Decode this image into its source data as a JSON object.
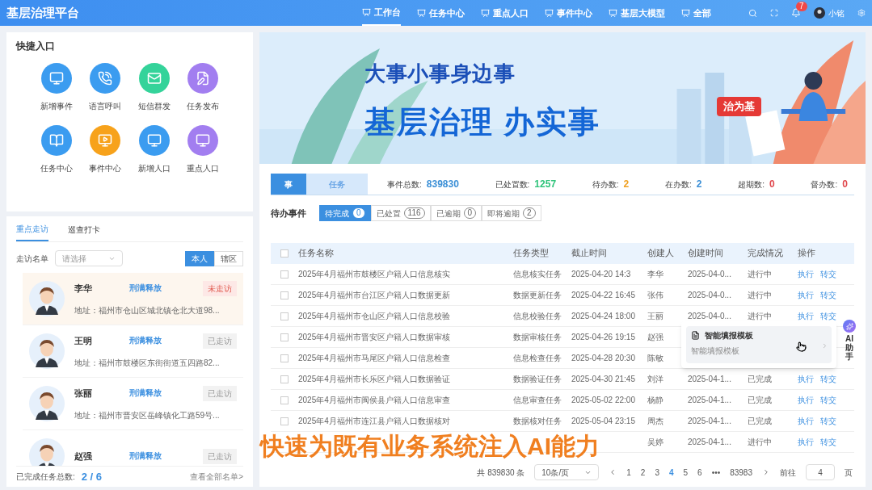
{
  "app": {
    "title": "基层治理平台"
  },
  "nav": [
    {
      "label": "工作台",
      "selected": true
    },
    {
      "label": "任务中心",
      "selected": false
    },
    {
      "label": "重点人口",
      "selected": false
    },
    {
      "label": "事件中心",
      "selected": false
    },
    {
      "label": "基层大模型",
      "selected": false
    },
    {
      "label": "全部",
      "selected": false
    }
  ],
  "notifications": {
    "badge": "7"
  },
  "user": {
    "name": "小铭"
  },
  "quick_entry": {
    "title": "快捷入口",
    "items": [
      {
        "label": "新增事件",
        "color": "#3b9cf0"
      },
      {
        "label": "语言呼叫",
        "color": "#3b9cf0"
      },
      {
        "label": "短信群发",
        "color": "#34d39a"
      },
      {
        "label": "任务发布",
        "color": "#a27ef0"
      },
      {
        "label": "任务中心",
        "color": "#3b9cf0"
      },
      {
        "label": "事件中心",
        "color": "#f7a21b"
      },
      {
        "label": "新增人口",
        "color": "#3b9cf0"
      },
      {
        "label": "重点人口",
        "color": "#a27ef0"
      }
    ]
  },
  "visits": {
    "tabs": [
      {
        "label": "重点走访",
        "selected": true
      },
      {
        "label": "巡查打卡",
        "selected": false
      }
    ],
    "filter": {
      "label": "走访名单",
      "placeholder": "请选择"
    },
    "scope": [
      {
        "label": "本人",
        "selected": true
      },
      {
        "label": "辖区",
        "selected": false
      }
    ],
    "people": [
      {
        "name": "李华",
        "tag": "刑满释放",
        "address": "地址：福州市仓山区城北镇仓北大道98...",
        "status": "未走访",
        "visited": false
      },
      {
        "name": "王明",
        "tag": "刑满释放",
        "address": "地址：福州市鼓楼区东街街道五四路82...",
        "status": "已走访",
        "visited": true
      },
      {
        "name": "张丽",
        "tag": "刑满释放",
        "address": "地址：福州市晋安区岳峰镇化工路59号...",
        "status": "已走访",
        "visited": true
      },
      {
        "name": "赵强",
        "tag": "刑满释放",
        "status": "已走访",
        "visited": true
      }
    ],
    "footer": {
      "label": "已完成任务总数:",
      "value": "2 / 6",
      "link": "查看全部名单>"
    }
  },
  "banner": {
    "slogan": "大事小事身边事",
    "headline": "基层治理 办实事",
    "badge": "治为基"
  },
  "stats": {
    "tabs": [
      {
        "label": "事",
        "selected": true
      },
      {
        "label": "任务",
        "selected": false
      }
    ],
    "items": [
      {
        "label": "事件总数:",
        "value": "839830",
        "color": "#3b8fd6"
      },
      {
        "label": "已处置数:",
        "value": "1257",
        "color": "#2fc37a"
      },
      {
        "label": "待办数:",
        "value": "2",
        "color": "#f0a020"
      },
      {
        "label": "在办数:",
        "value": "2",
        "color": "#3b8fd6"
      },
      {
        "label": "超期数:",
        "value": "0",
        "color": "#e0474c"
      },
      {
        "label": "督办数:",
        "value": "0",
        "color": "#e0474c"
      }
    ]
  },
  "pending": {
    "title": "待办事件",
    "tabs": [
      {
        "label": "待完成",
        "count": "0",
        "selected": true
      },
      {
        "label": "已处置",
        "count": "116",
        "selected": false
      },
      {
        "label": "已逾期",
        "count": "0",
        "selected": false
      },
      {
        "label": "即将逾期",
        "count": "2",
        "selected": false
      }
    ]
  },
  "table": {
    "all_checked": false,
    "columns": [
      "任务名称",
      "任务类型",
      "截止时间",
      "创建人",
      "创建时间",
      "完成情况",
      "操作"
    ],
    "rows": [
      {
        "checked": false,
        "name": "2025年4月福州市鼓楼区户籍人口信息核实",
        "type": "信息核实任务",
        "deadline": "2025-04-20 14:3",
        "creator": "李华",
        "created": "2025-04-0...",
        "status": "进行中",
        "actions": [
          "执行",
          "转交"
        ]
      },
      {
        "checked": false,
        "name": "2025年4月福州市台江区户籍人口数据更新",
        "type": "数据更新任务",
        "deadline": "2025-04-22 16:45",
        "creator": "张伟",
        "created": "2025-04-0...",
        "status": "进行中",
        "actions": [
          "执行",
          "转交"
        ]
      },
      {
        "checked": false,
        "name": "2025年4月福州市仓山区户籍人口信息校验",
        "type": "信息校验任务",
        "deadline": "2025-04-24 18:00",
        "creator": "王丽",
        "created": "2025-04-0...",
        "status": "进行中",
        "actions": [
          "执行",
          "转交"
        ]
      },
      {
        "checked": false,
        "name": "2025年4月福州市晋安区户籍人口数据审核",
        "type": "数据审核任务",
        "deadline": "2025-04-26 19:15",
        "creator": "赵强"
      },
      {
        "checked": false,
        "name": "2025年4月福州市马尾区户籍人口信息检查",
        "type": "信息检查任务",
        "deadline": "2025-04-28 20:30",
        "creator": "陈敏"
      },
      {
        "checked": false,
        "name": "2025年4月福州市长乐区户籍人口数据验证",
        "type": "数据验证任务",
        "deadline": "2025-04-30 21:45",
        "creator": "刘洋",
        "created": "2025-04-1...",
        "status": "已完成",
        "actions": [
          "执行",
          "转交"
        ]
      },
      {
        "checked": false,
        "name": "2025年4月福州市闽侯县户籍人口信息审查",
        "type": "信息审查任务",
        "deadline": "2025-05-02 22:00",
        "creator": "杨静",
        "created": "2025-04-1...",
        "status": "已完成",
        "actions": [
          "执行",
          "转交"
        ]
      },
      {
        "checked": false,
        "name": "2025年4月福州市连江县户籍人口数据核对",
        "type": "数据核对任务",
        "deadline": "2025-05-04 23:15",
        "creator": "周杰",
        "created": "2025-04-1...",
        "status": "已完成",
        "actions": [
          "执行",
          "转交"
        ]
      },
      {
        "creator": "吴婷",
        "created": "2025-04-1...",
        "status": "进行中",
        "actions": [
          "执行",
          "转交"
        ]
      }
    ]
  },
  "pagination": {
    "total": "共 839830 条",
    "page_size": "10条/页",
    "pages": [
      {
        "label": "1",
        "selected": false
      },
      {
        "label": "2",
        "selected": false
      },
      {
        "label": "3",
        "selected": false
      },
      {
        "label": "4",
        "selected": true
      },
      {
        "label": "5",
        "selected": false
      },
      {
        "label": "6",
        "selected": false
      },
      {
        "label": "•••",
        "selected": false
      },
      {
        "label": "83983",
        "selected": false
      }
    ],
    "goto_label": "前往",
    "goto_value": "4",
    "goto_unit": "页"
  },
  "popup": {
    "title": "智能填报模板",
    "subtitle": "智能填报模板"
  },
  "assistant": {
    "label": "AI助手"
  },
  "caption": "快速为既有业务系统注入AI能力"
}
